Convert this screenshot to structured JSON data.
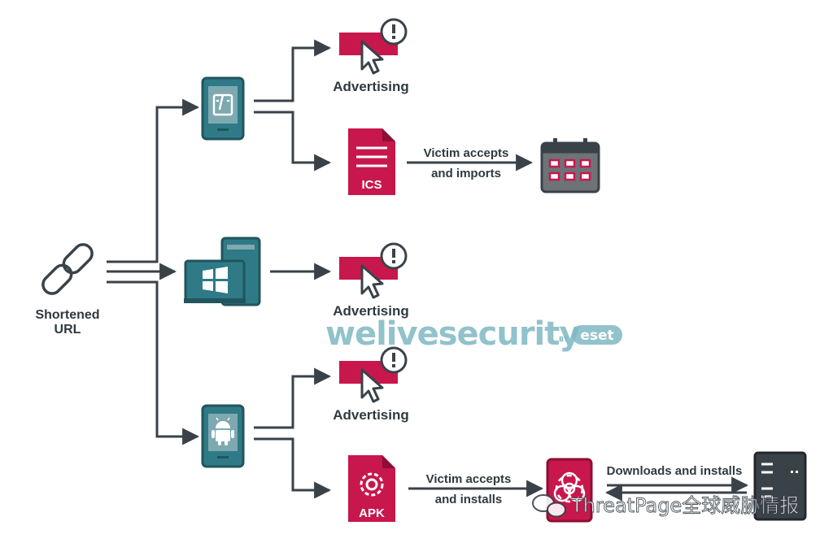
{
  "source": {
    "label_line1": "Shortened",
    "label_line2": "URL",
    "icon": "chain-link-icon"
  },
  "branches": {
    "ios": {
      "device_icon": "ios-phone-icon",
      "advertising_label": "Advertising",
      "file_label": "ICS",
      "action_line1": "Victim accepts",
      "action_line2": "and imports",
      "target_icon": "calendar-icon"
    },
    "windows": {
      "device_icon": "windows-desktop-icon",
      "advertising_label": "Advertising"
    },
    "android": {
      "device_icon": "android-phone-icon",
      "advertising_label": "Advertising",
      "file_label": "APK",
      "action_line1": "Victim accepts",
      "action_line2": "and installs",
      "malware_icon": "biohazard-device-icon",
      "c2_action_label": "Downloads and installs",
      "c2_icon": "server-icon"
    }
  },
  "watermarks": {
    "brand": "welivesecurity",
    "by": "BY",
    "eset": "eset",
    "wechat_text": "ThreatPage全球威胁情报"
  },
  "colors": {
    "crimson": "#c8174c",
    "teal": "#2f7a86",
    "teal_dark": "#21555e",
    "gray_dark": "#3a4249",
    "calendar_gray": "#6e7378",
    "watermark_teal": "#7fb8c3"
  }
}
